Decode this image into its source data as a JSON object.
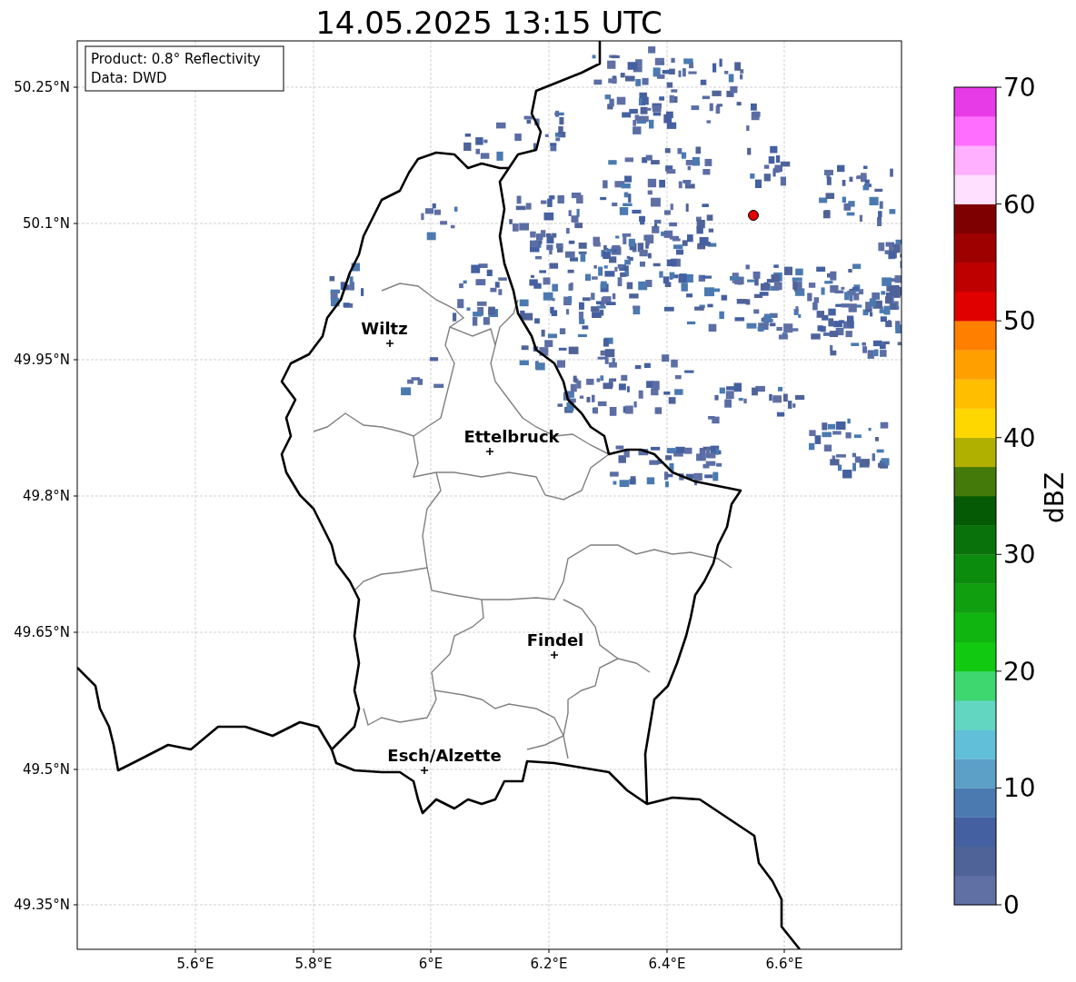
{
  "title": "14.05.2025 13:15 UTC",
  "info_box": [
    "Product: 0.8° Reflectivity",
    "Data: DWD"
  ],
  "map": {
    "cities": [
      {
        "name": "Wiltz"
      },
      {
        "name": "Ettelbruck"
      },
      {
        "name": "Findel"
      },
      {
        "name": "Esch/Alzette"
      }
    ],
    "y_ticks": [
      "50.25°N",
      "50.1°N",
      "49.95°N",
      "49.8°N",
      "49.65°N",
      "49.5°N",
      "49.35°N"
    ],
    "x_ticks": [
      "5.6°E",
      "5.8°E",
      "6°E",
      "6.2°E",
      "6.4°E",
      "6.6°E"
    ]
  },
  "colorbar": {
    "label": "dBZ",
    "ticks": [
      "70",
      "60",
      "50",
      "40",
      "30",
      "20",
      "10",
      "0"
    ],
    "segments": [
      {
        "color": "#6070a5"
      },
      {
        "color": "#4f6399"
      },
      {
        "color": "#4560a0"
      },
      {
        "color": "#4a7ab0"
      },
      {
        "color": "#5ca0c8"
      },
      {
        "color": "#62bfd9"
      },
      {
        "color": "#62d6c1"
      },
      {
        "color": "#3ed66e"
      },
      {
        "color": "#12c912"
      },
      {
        "color": "#10b510"
      },
      {
        "color": "#0f9f0f"
      },
      {
        "color": "#0c8c0c"
      },
      {
        "color": "#0a720a"
      },
      {
        "color": "#055a05"
      },
      {
        "color": "#437a0a"
      },
      {
        "color": "#b0b000"
      },
      {
        "color": "#ffd700"
      },
      {
        "color": "#ffbf00"
      },
      {
        "color": "#ff9f00"
      },
      {
        "color": "#ff7f00"
      },
      {
        "color": "#e00000"
      },
      {
        "color": "#bf0000"
      },
      {
        "color": "#9e0000"
      },
      {
        "color": "#7f0000"
      },
      {
        "color": "#ffe0ff"
      },
      {
        "color": "#ffb0ff"
      },
      {
        "color": "#ff6eff"
      },
      {
        "color": "#e83be8"
      }
    ]
  }
}
